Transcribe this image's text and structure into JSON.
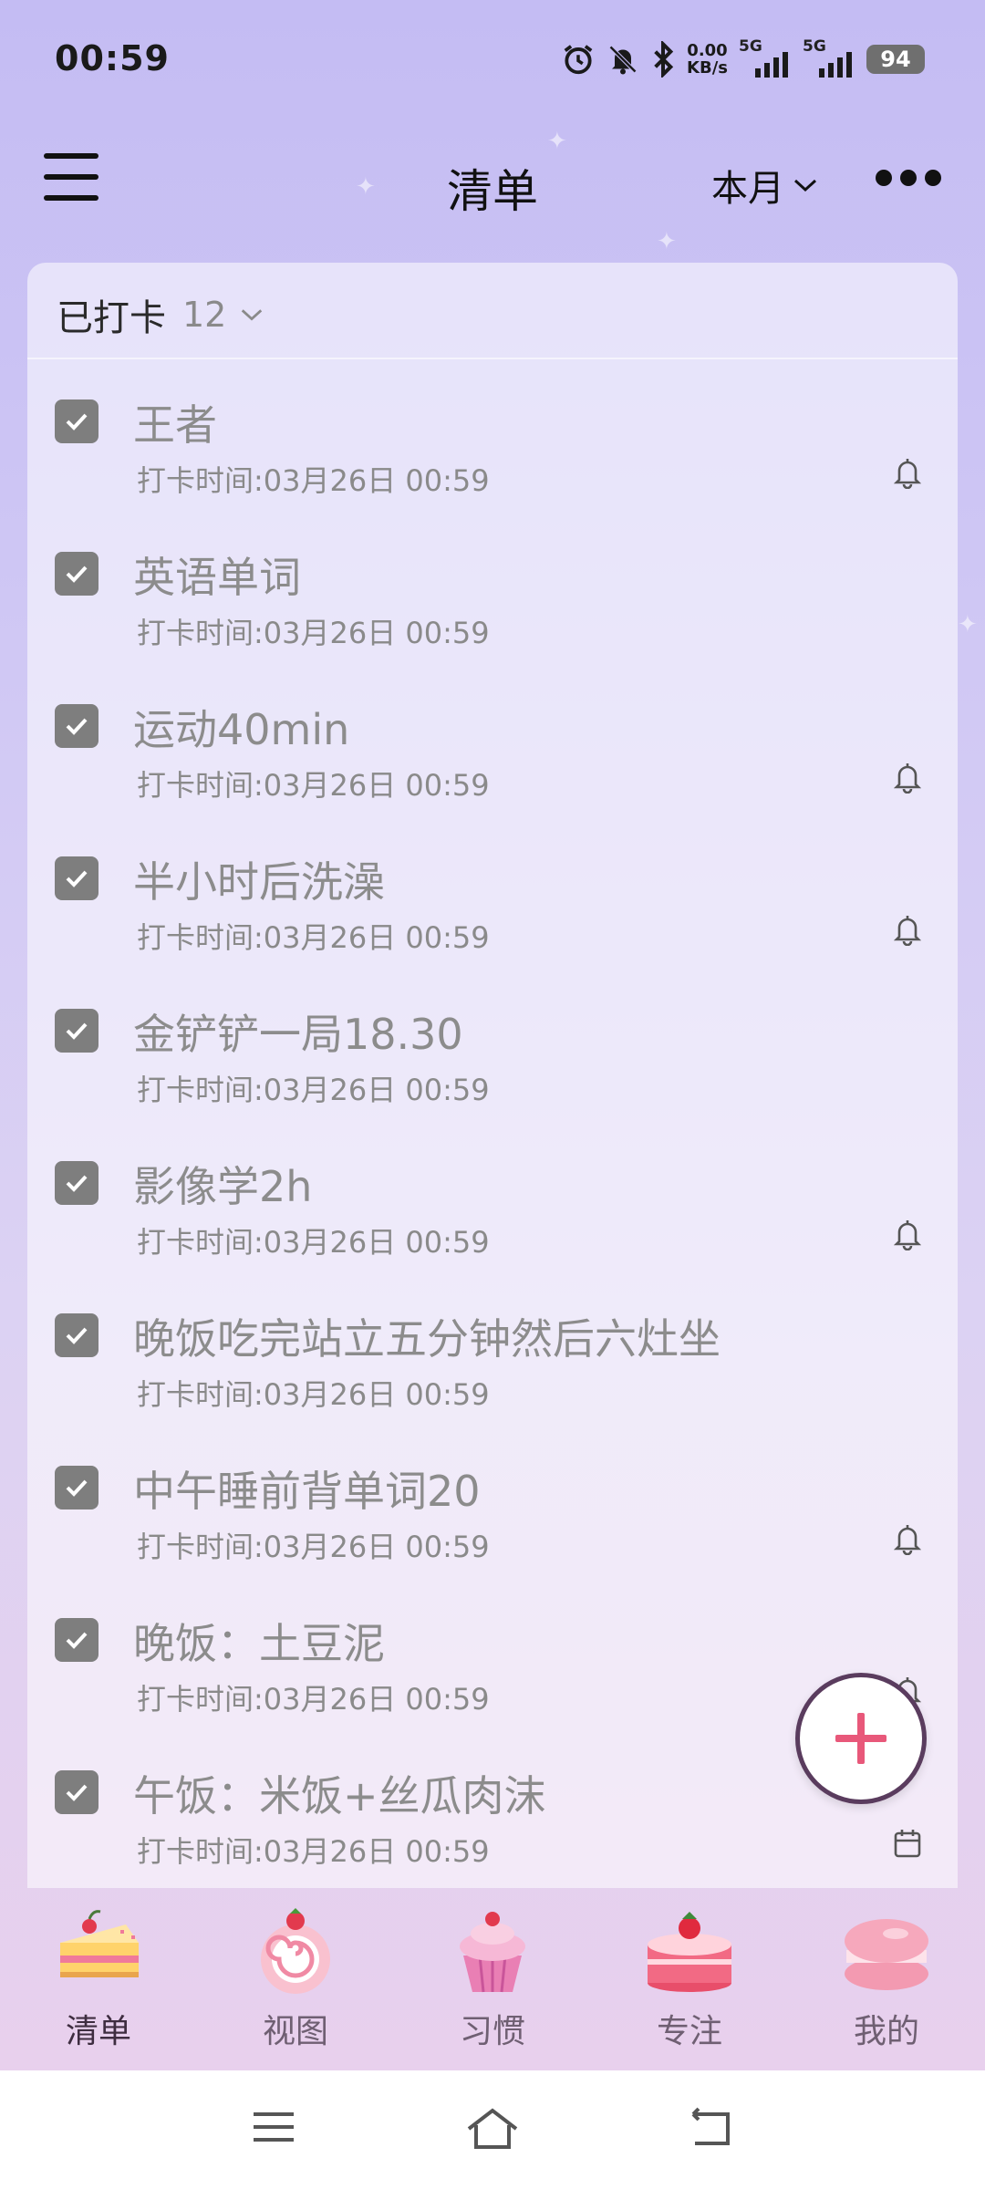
{
  "status_bar": {
    "time": "00:59",
    "net_speed_value": "0.00",
    "net_speed_unit": "KB/s",
    "signal_1_label": "5G",
    "signal_2_label": "5G",
    "battery": "94"
  },
  "header": {
    "title": "清单",
    "period": "本月"
  },
  "group": {
    "title": "已打卡",
    "count": "12"
  },
  "tasks": [
    {
      "title": "王者",
      "time": "打卡时间:03月26日 00:59",
      "icon": "bell-icon"
    },
    {
      "title": "英语单词",
      "time": "打卡时间:03月26日 00:59",
      "icon": ""
    },
    {
      "title": "运动40min",
      "time": "打卡时间:03月26日 00:59",
      "icon": "bell-icon"
    },
    {
      "title": "半小时后洗澡",
      "time": "打卡时间:03月26日 00:59",
      "icon": "bell-icon"
    },
    {
      "title": "金铲铲一局18.30",
      "time": "打卡时间:03月26日 00:59",
      "icon": ""
    },
    {
      "title": "影像学2h",
      "time": "打卡时间:03月26日 00:59",
      "icon": "bell-icon"
    },
    {
      "title": "晚饭吃完站立五分钟然后六灶坐",
      "time": "打卡时间:03月26日 00:59",
      "icon": ""
    },
    {
      "title": "中午睡前背单词20",
      "time": "打卡时间:03月26日 00:59",
      "icon": "bell-icon"
    },
    {
      "title": "晚饭：土豆泥",
      "time": "打卡时间:03月26日 00:59",
      "icon": "bell-icon"
    },
    {
      "title": "午饭：米饭+丝瓜肉沫",
      "time": "打卡时间:03月26日 00:59",
      "icon": "calendar-icon"
    }
  ],
  "nav": [
    {
      "label": "清单",
      "icon": "cake-slice-icon",
      "active": true
    },
    {
      "label": "视图",
      "icon": "swiss-roll-icon",
      "active": false
    },
    {
      "label": "习惯",
      "icon": "cupcake-icon",
      "active": false
    },
    {
      "label": "专注",
      "icon": "strawberry-cake-icon",
      "active": false
    },
    {
      "label": "我的",
      "icon": "macaron-icon",
      "active": false
    }
  ],
  "colors": {
    "accent": "#e8587a",
    "fab_border": "#5a3c5e",
    "checkbox": "#7e7e7e",
    "muted_text": "#8c8c8c"
  }
}
